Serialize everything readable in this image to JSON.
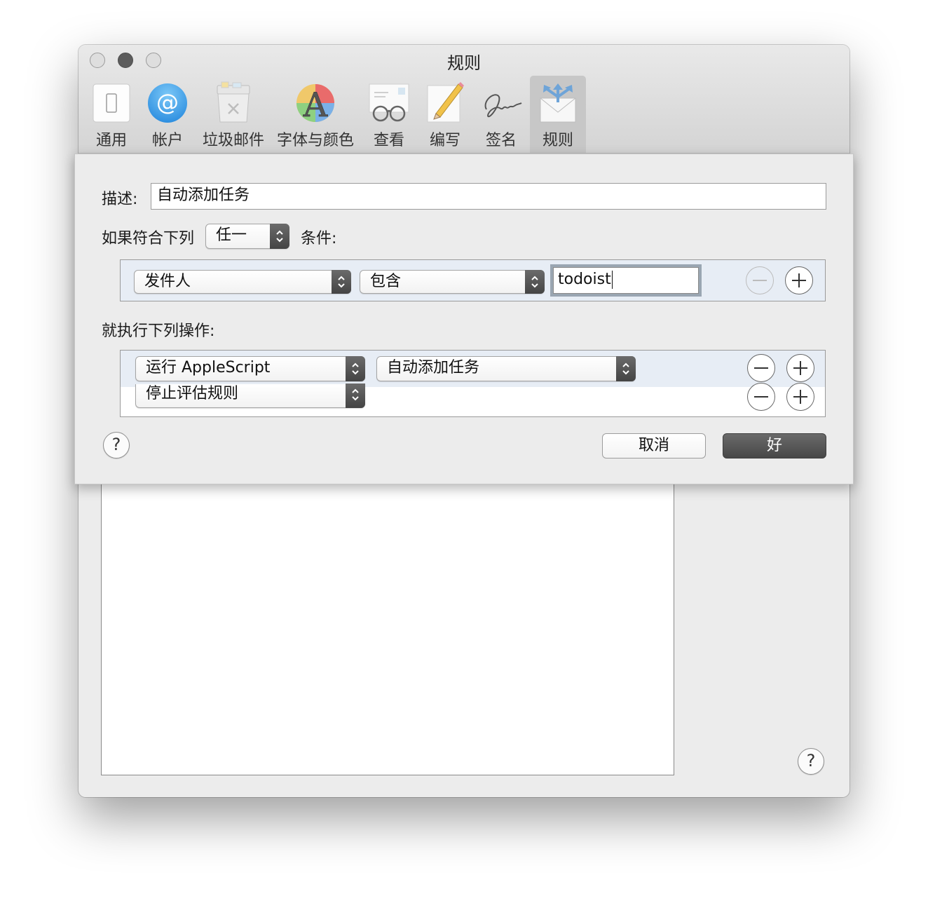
{
  "window": {
    "title": "规则"
  },
  "toolbar": {
    "items": [
      {
        "label": "通用",
        "icon": "switch-icon"
      },
      {
        "label": "帐户",
        "icon": "at-sign-icon"
      },
      {
        "label": "垃圾邮件",
        "icon": "trash-bin-icon"
      },
      {
        "label": "字体与颜色",
        "icon": "font-color-icon"
      },
      {
        "label": "查看",
        "icon": "glasses-letter-icon"
      },
      {
        "label": "编写",
        "icon": "pencil-paper-icon"
      },
      {
        "label": "签名",
        "icon": "signature-icon"
      },
      {
        "label": "规则",
        "icon": "rules-envelope-icon",
        "selected": true
      }
    ]
  },
  "sheet": {
    "description_label": "描述:",
    "description_value": "自动添加任务",
    "match_prefix": "如果符合下列",
    "match_value": "任一",
    "match_suffix": "条件:",
    "criteria": [
      {
        "field": "发件人",
        "operator": "包含",
        "value": "todoist"
      }
    ],
    "actions_label": "就执行下列操作:",
    "actions": [
      {
        "action": "运行 AppleScript",
        "target": "自动添加任务"
      },
      {
        "action": "停止评估规则"
      }
    ],
    "cancel_label": "取消",
    "ok_label": "好",
    "help_label": "?"
  },
  "background": {
    "help_label": "?"
  },
  "colors": {
    "selected_row": "#e7edf5",
    "default_button": "#474747",
    "focus_ring": "#9aa6b2"
  }
}
